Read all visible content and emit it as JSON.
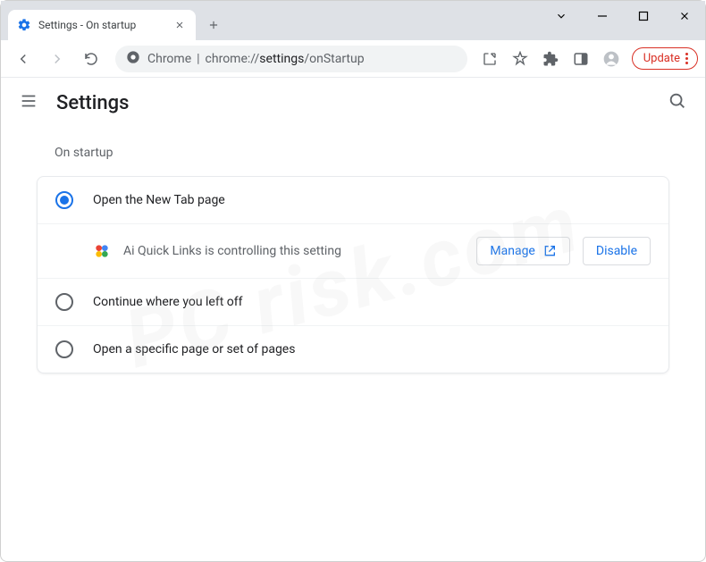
{
  "tab": {
    "title": "Settings - On startup"
  },
  "addressbar": {
    "prefix": "Chrome",
    "protocol": "chrome://",
    "path": "settings",
    "subpath": "/onStartup"
  },
  "toolbar": {
    "update_label": "Update"
  },
  "header": {
    "title": "Settings"
  },
  "section": {
    "title": "On startup"
  },
  "options": [
    {
      "label": "Open the New Tab page",
      "checked": true
    },
    {
      "label": "Continue where you left off",
      "checked": false
    },
    {
      "label": "Open a specific page or set of pages",
      "checked": false
    }
  ],
  "extension_notice": {
    "text": "Ai Quick Links is controlling this setting",
    "manage_label": "Manage",
    "disable_label": "Disable"
  }
}
